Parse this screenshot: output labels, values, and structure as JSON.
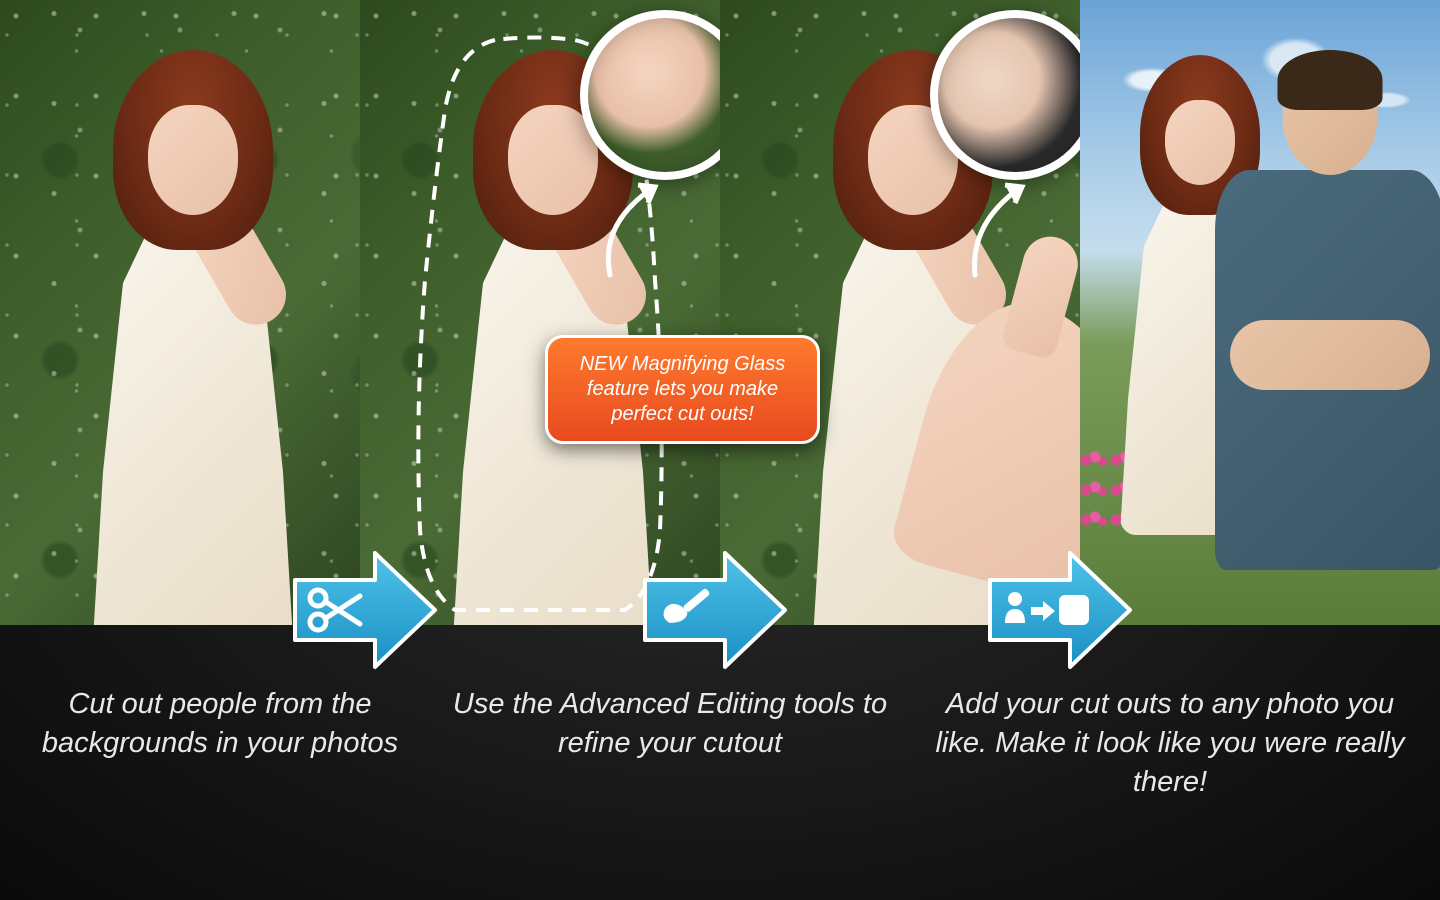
{
  "callout": {
    "text": "NEW Magnifying Glass feature lets you make perfect cut outs!"
  },
  "steps": [
    {
      "icon": "scissors",
      "caption": "Cut out people from the backgrounds in your photos"
    },
    {
      "icon": "brush",
      "caption": "Use the Advanced Editing tools to refine your cutout"
    },
    {
      "icon": "person-to-photo",
      "caption": "Add your cut outs to any photo you like. Make it look like you were really there!"
    }
  ],
  "colors": {
    "arrow_gradient_top": "#4fc3e8",
    "arrow_gradient_bottom": "#1a8fc4",
    "callout_top": "#ff7a2e",
    "callout_bottom": "#e84a1e"
  }
}
